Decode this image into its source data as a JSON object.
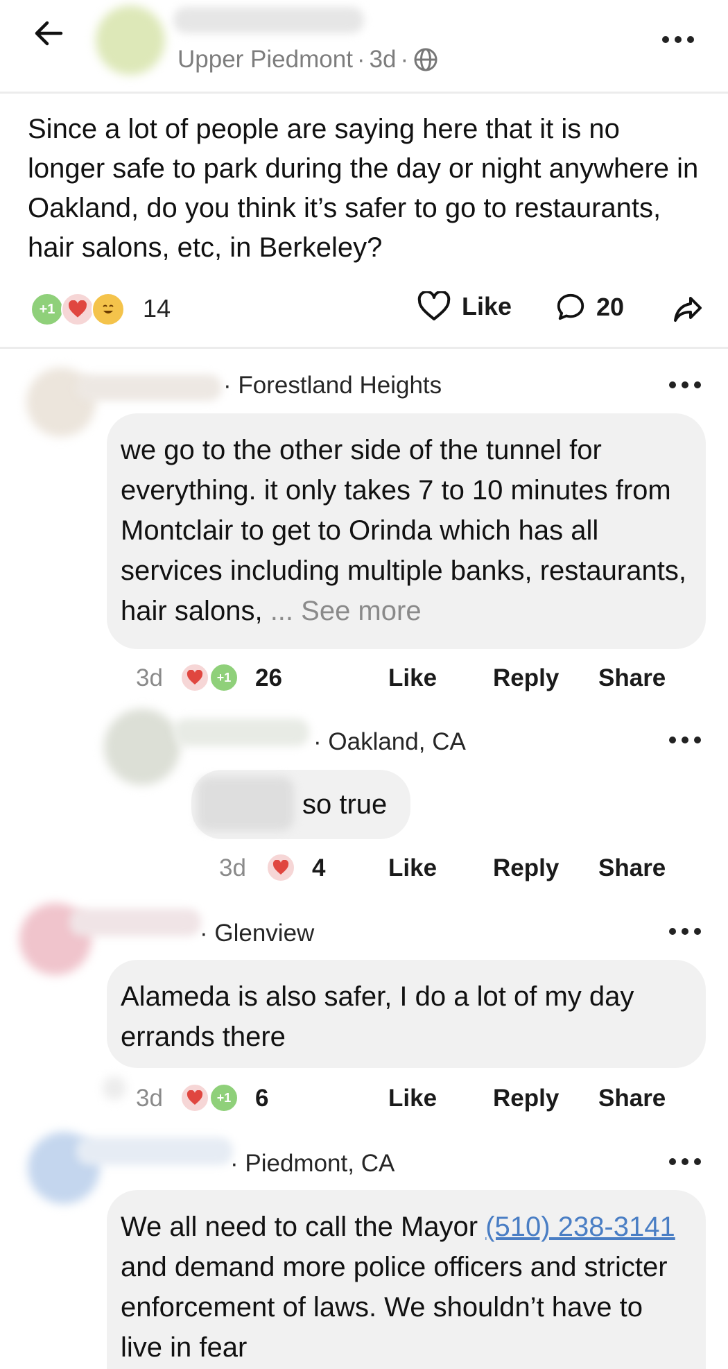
{
  "header": {
    "location": "Upper Piedmont",
    "time": "3d",
    "sep": "·"
  },
  "post": {
    "body": "Since a lot of people are saying here that it is no longer safe to park during the day or night anywhere in Oakland, do you think it’s safer to go to restaurants, hair salons, etc, in Berkeley?",
    "reaction_count": "14",
    "like_label": "Like",
    "comment_count": "20"
  },
  "comments": [
    {
      "location": "· Forestland Heights",
      "text": "we go to the other side of the tunnel for everything. it only takes 7 to 10 minutes from Montclair to get to Orinda which has all services including multiple banks, restaurants, hair salons,",
      "see_more": "... See more",
      "time": "3d",
      "count": "26",
      "like": "Like",
      "reply": "Reply",
      "share": "Share"
    },
    {
      "location": "· Oakland, CA",
      "text": "so true",
      "time": "3d",
      "count": "4",
      "like": "Like",
      "reply": "Reply",
      "share": "Share"
    },
    {
      "location": "· Glenview",
      "text": "Alameda is also safer, I do a lot of my day errands there",
      "time": "3d",
      "count": "6",
      "like": "Like",
      "reply": "Reply",
      "share": "Share"
    },
    {
      "location": "· Piedmont, CA",
      "text_before": "We all need to call the Mayor ",
      "phone": "(510) 238-3141",
      "text_after": " and demand more police officers and stricter enforcement of laws. We shouldn’t have to live in fear"
    }
  ],
  "reactions": {
    "plus_one": "+1"
  },
  "colors": {
    "link": "#4a7ec4",
    "bubble": "#f1f1f1",
    "heart": "#e0463f"
  }
}
